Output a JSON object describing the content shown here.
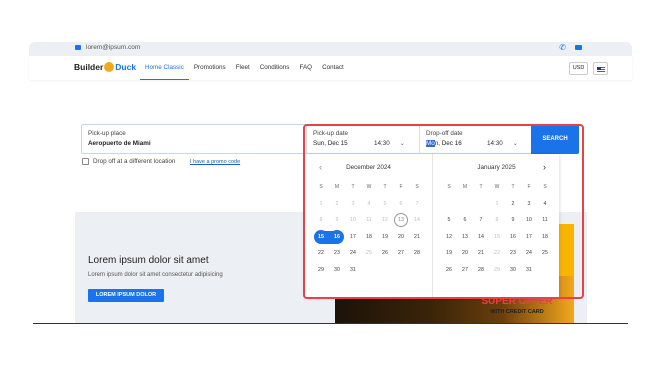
{
  "topbar": {
    "email": "lorem@ipsum.com"
  },
  "nav": {
    "logo_part1": "Builder",
    "logo_part2": "Duck",
    "links": [
      "Home Classic",
      "Promotions",
      "Fleet",
      "Conditions",
      "FAQ",
      "Contact"
    ],
    "active": "Home Classic",
    "currency": "USD"
  },
  "booking": {
    "pickup_place_label": "Pick-up place",
    "pickup_place_value": "Aeropuerto de Miami",
    "pickup_date_label": "Pick-up date",
    "pickup_date_value": "Sun, Dec 15",
    "pickup_time": "14:30",
    "dropoff_date_label": "Drop-off date",
    "dropoff_date_hl": "Mo",
    "dropoff_date_rest": "n, Dec 16",
    "dropoff_time": "14:30",
    "search_label": "SEARCH",
    "dropoff_different_label": "Drop off at a different location",
    "promo_link": "I have a promo code"
  },
  "calendar": {
    "weekdays": [
      "S",
      "M",
      "T",
      "W",
      "T",
      "F",
      "S"
    ],
    "months": [
      {
        "title": "December 2024",
        "days": [
          {
            "d": "1",
            "s": "dis"
          },
          {
            "d": "2",
            "s": "dis"
          },
          {
            "d": "3",
            "s": "dis"
          },
          {
            "d": "4",
            "s": "dis"
          },
          {
            "d": "5",
            "s": "dis"
          },
          {
            "d": "6",
            "s": "dis"
          },
          {
            "d": "7",
            "s": "dis"
          },
          {
            "d": "8",
            "s": "dis"
          },
          {
            "d": "9",
            "s": "dis"
          },
          {
            "d": "10",
            "s": "dis"
          },
          {
            "d": "11",
            "s": "dis"
          },
          {
            "d": "12",
            "s": "dis"
          },
          {
            "d": "13",
            "s": "today"
          },
          {
            "d": "14",
            "s": "dis"
          },
          {
            "d": "15",
            "s": "start"
          },
          {
            "d": "16",
            "s": "end"
          },
          {
            "d": "17"
          },
          {
            "d": "18"
          },
          {
            "d": "19"
          },
          {
            "d": "20"
          },
          {
            "d": "21"
          },
          {
            "d": "22"
          },
          {
            "d": "23"
          },
          {
            "d": "24"
          },
          {
            "d": "25",
            "s": "dis"
          },
          {
            "d": "26"
          },
          {
            "d": "27"
          },
          {
            "d": "28"
          },
          {
            "d": "29"
          },
          {
            "d": "30"
          },
          {
            "d": "31"
          }
        ]
      },
      {
        "title": "January 2025",
        "days": [
          {
            "d": ""
          },
          {
            "d": ""
          },
          {
            "d": ""
          },
          {
            "d": "1",
            "s": "dis"
          },
          {
            "d": "2"
          },
          {
            "d": "3"
          },
          {
            "d": "4"
          },
          {
            "d": "5"
          },
          {
            "d": "6"
          },
          {
            "d": "7"
          },
          {
            "d": "8",
            "s": "dis"
          },
          {
            "d": "9"
          },
          {
            "d": "10"
          },
          {
            "d": "11"
          },
          {
            "d": "12"
          },
          {
            "d": "13"
          },
          {
            "d": "14"
          },
          {
            "d": "15",
            "s": "dis"
          },
          {
            "d": "16"
          },
          {
            "d": "17"
          },
          {
            "d": "18"
          },
          {
            "d": "19"
          },
          {
            "d": "20"
          },
          {
            "d": "21"
          },
          {
            "d": "22",
            "s": "dis"
          },
          {
            "d": "23"
          },
          {
            "d": "24"
          },
          {
            "d": "25"
          },
          {
            "d": "26"
          },
          {
            "d": "27"
          },
          {
            "d": "28"
          },
          {
            "d": "29",
            "s": "dis"
          },
          {
            "d": "30"
          },
          {
            "d": "31"
          }
        ]
      }
    ]
  },
  "hero": {
    "title": "Lorem ipsum dolor sit amet",
    "subtitle": "Lorem ipsum dolor sit amet consectetur adipisicing",
    "button": "LOREM IPSUM DOLOR",
    "offer_title": "SUPER OFFER",
    "offer_sub": "WITH CREDIT CARD"
  },
  "colors": {
    "accent": "#1a73e8",
    "highlight_border": "#e8414a",
    "brand_yellow": "#f3a81c"
  }
}
